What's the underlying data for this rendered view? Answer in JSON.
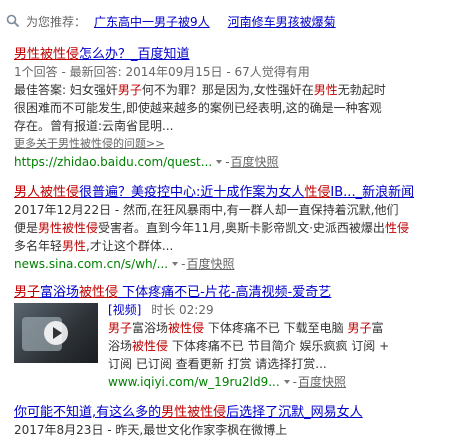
{
  "recommend": {
    "label": "为您推荐：",
    "links": [
      "广东高中一男子被9人",
      "河南修车男孩被爆菊"
    ]
  },
  "results": [
    {
      "title": [
        "男性被性侵",
        "怎么办？_百度知道"
      ],
      "meta": "1个回答 - 最新回答: 2014年09月15日 - 67人觉得有用",
      "lines": [
        [
          "最佳答案: 妇女强奸",
          "男子",
          "何不为罪？那是因为,女性强奸在",
          "男性",
          "无勃起时"
        ],
        [
          "很困难而不可能发生,即使越来越多的案例已经表明,这的确是一种客观"
        ],
        [
          "存在。曾有报道:云南省昆明..."
        ]
      ],
      "more": "更多关于男性被性侵的问题>>",
      "url": "https://zhidao.baidu.com/quest...",
      "snapshot": "百度快照"
    },
    {
      "title": [
        "男人被性侵",
        "很普遍？美疫控中心:近十成作案为女人",
        "性侵",
        "IB..._新浪新闻"
      ],
      "lines": [
        [
          "2017年12月22日 - 然而,在狂风暴雨中,有一群人却一直保持着沉默,他们"
        ],
        [
          "便是",
          "男性被性侵",
          "受害者。直到今年11月,奥斯卡影帝凯文·史派西被爆出",
          "性侵"
        ],
        [
          "多名年轻",
          "男性",
          ",才让这个群体..."
        ]
      ],
      "url": "news.sina.com.cn/s/wh/...",
      "snapshot": "百度快照"
    },
    {
      "title": [
        "男子",
        "富浴场",
        "被性侵",
        " 下体疼痛不已-片花-高清视频-爱奇艺"
      ],
      "video_tag": "[视频]",
      "duration": "时长 02:29",
      "lines": [
        [
          "男子",
          "富浴场",
          "被性侵",
          " 下体疼痛不已 下载至电脑 ",
          "男子",
          "富"
        ],
        [
          "浴场",
          "被性侵",
          " 下体疼痛不已 节目简介 娱乐疯疯 订阅 +"
        ],
        [
          "订阅 已订阅 查看更新 打赏 请选择打赏..."
        ]
      ],
      "url": "www.iqiyi.com/w_19ru2ld9...",
      "snapshot": "百度快照"
    },
    {
      "title": [
        "你可能不知道,有这么多的",
        "男性被性侵",
        "后选择了沉默_网易女人"
      ],
      "lines": [
        [
          "2017年8月23日 - 昨天,最世文化作家李枫在微博上"
        ]
      ]
    }
  ]
}
